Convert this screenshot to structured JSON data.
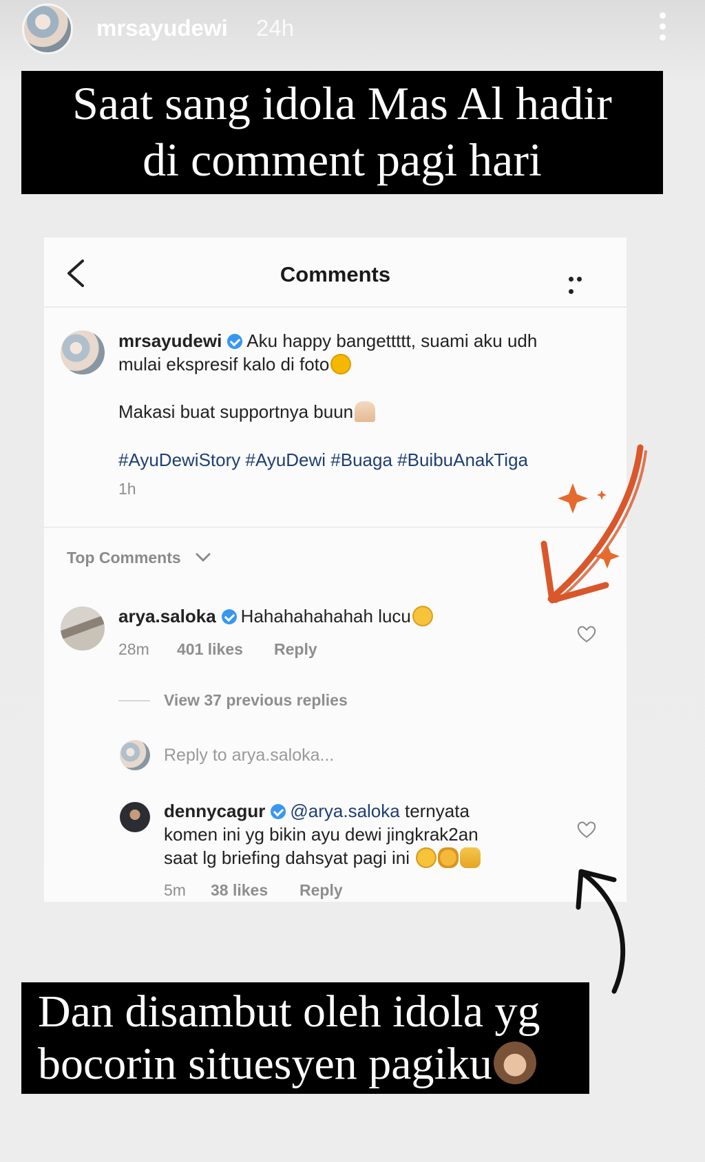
{
  "story": {
    "username": "mrsayudewi",
    "time": "24h"
  },
  "captions": {
    "top": [
      "Saat sang idola Mas Al hadir",
      "di comment pagi hari"
    ],
    "bottom": [
      "Dan disambut oleh idola yg",
      "bocorin situesyen pagiku"
    ]
  },
  "screenshot": {
    "title": "Comments",
    "post": {
      "username": "mrsayudewi",
      "line1": "Aku happy bangettttt, suami aku udh",
      "line2": "mulai ekspresif kalo di foto",
      "line3": "Makasi buat supportnya buun",
      "hashtags": "#AyuDewiStory #AyuDewi #Buaga #BuibuAnakTiga",
      "time": "1h"
    },
    "sort_label": "Top Comments",
    "comment": {
      "username": "arya.saloka",
      "text": "Hahahahahahah lucu",
      "time": "28m",
      "likes": "401 likes",
      "reply": "Reply"
    },
    "view_replies": "View 37 previous replies",
    "reply_placeholder": "Reply to arya.saloka...",
    "reply": {
      "username": "dennycagur",
      "mention": "@arya.saloka",
      "line1_rest": "ternyata",
      "line2": "komen ini yg bikin ayu dewi jingkrak2an",
      "line3": "saat lg briefing dahsyat pagi ini",
      "time": "5m",
      "likes": "38 likes",
      "reply": "Reply"
    }
  },
  "colors": {
    "verified": "#3897f0",
    "hashtag": "#1e3f73",
    "caption_bg": "#000000",
    "arrow_orange": "#d9572b",
    "arrow_black": "#111111"
  },
  "icons": [
    "back-icon",
    "more-icon",
    "verified-icon",
    "heart-icon",
    "chevron-down-icon",
    "arrow-doodle",
    "sparkle-icon"
  ]
}
